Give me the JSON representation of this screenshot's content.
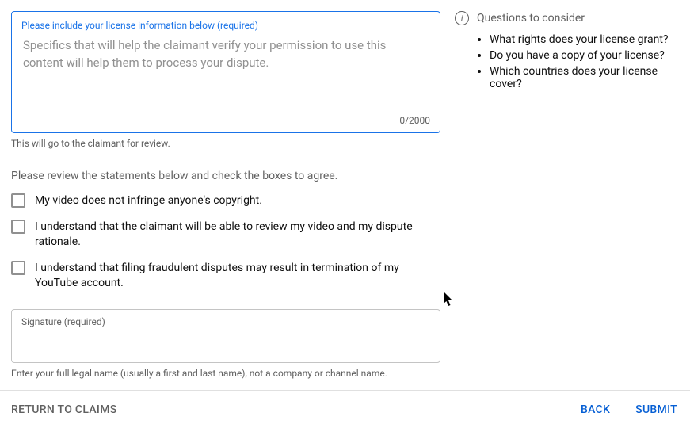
{
  "license": {
    "label": "Please include your license information below (required)",
    "placeholder": "Specifics that will help the claimant verify your permission to use this content will help them to process your dispute.",
    "char_count": "0/2000",
    "helper": "This will go to the claimant for review."
  },
  "review": {
    "intro": "Please review the statements below and check the boxes to agree.",
    "statements": [
      "My video does not infringe anyone's copyright.",
      "I understand that the claimant will be able to review my video and my dispute rationale.",
      "I understand that filing fraudulent disputes may result in termination of my YouTube account."
    ]
  },
  "signature": {
    "label": "Signature (required)",
    "helper": "Enter your full legal name (usually a first and last name), not a company or channel name."
  },
  "sidebar": {
    "heading": "Questions to consider",
    "items": [
      "What rights does your license grant?",
      "Do you have a copy of your license?",
      "Which countries does your license cover?"
    ]
  },
  "footer": {
    "return": "RETURN TO CLAIMS",
    "back": "BACK",
    "submit": "SUBMIT"
  }
}
